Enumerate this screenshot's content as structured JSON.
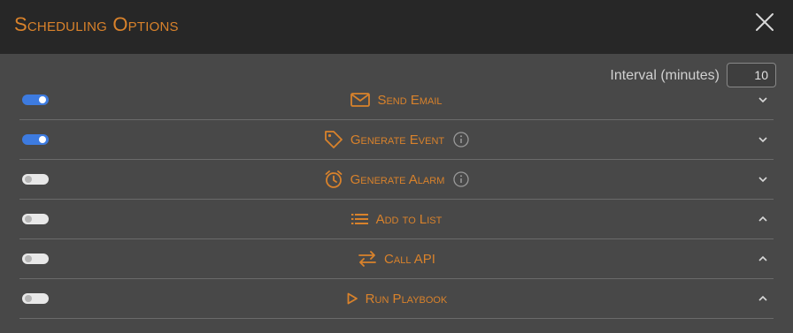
{
  "dialog": {
    "title": "Scheduling Options",
    "close_icon": "close-icon"
  },
  "interval": {
    "label": "Interval (minutes)",
    "value": "10"
  },
  "actions": [
    {
      "label": "Send Email",
      "enabled": true,
      "icon": "envelope-icon",
      "has_info": false,
      "expanded": false
    },
    {
      "label": "Generate Event",
      "enabled": true,
      "icon": "tag-icon",
      "has_info": true,
      "expanded": false
    },
    {
      "label": "Generate Alarm",
      "enabled": false,
      "icon": "alarm-clock-icon",
      "has_info": true,
      "expanded": false
    },
    {
      "label": "Add to List",
      "enabled": false,
      "icon": "list-icon",
      "has_info": false,
      "expanded": true
    },
    {
      "label": "Call API",
      "enabled": false,
      "icon": "swap-arrows-icon",
      "has_info": false,
      "expanded": true
    },
    {
      "label": "Run Playbook",
      "enabled": false,
      "icon": "play-icon",
      "has_info": false,
      "expanded": true
    }
  ],
  "colors": {
    "accent": "#d9822b",
    "toggle_on": "#3d7be0",
    "header_bg": "#272727",
    "body_bg": "#484848"
  }
}
